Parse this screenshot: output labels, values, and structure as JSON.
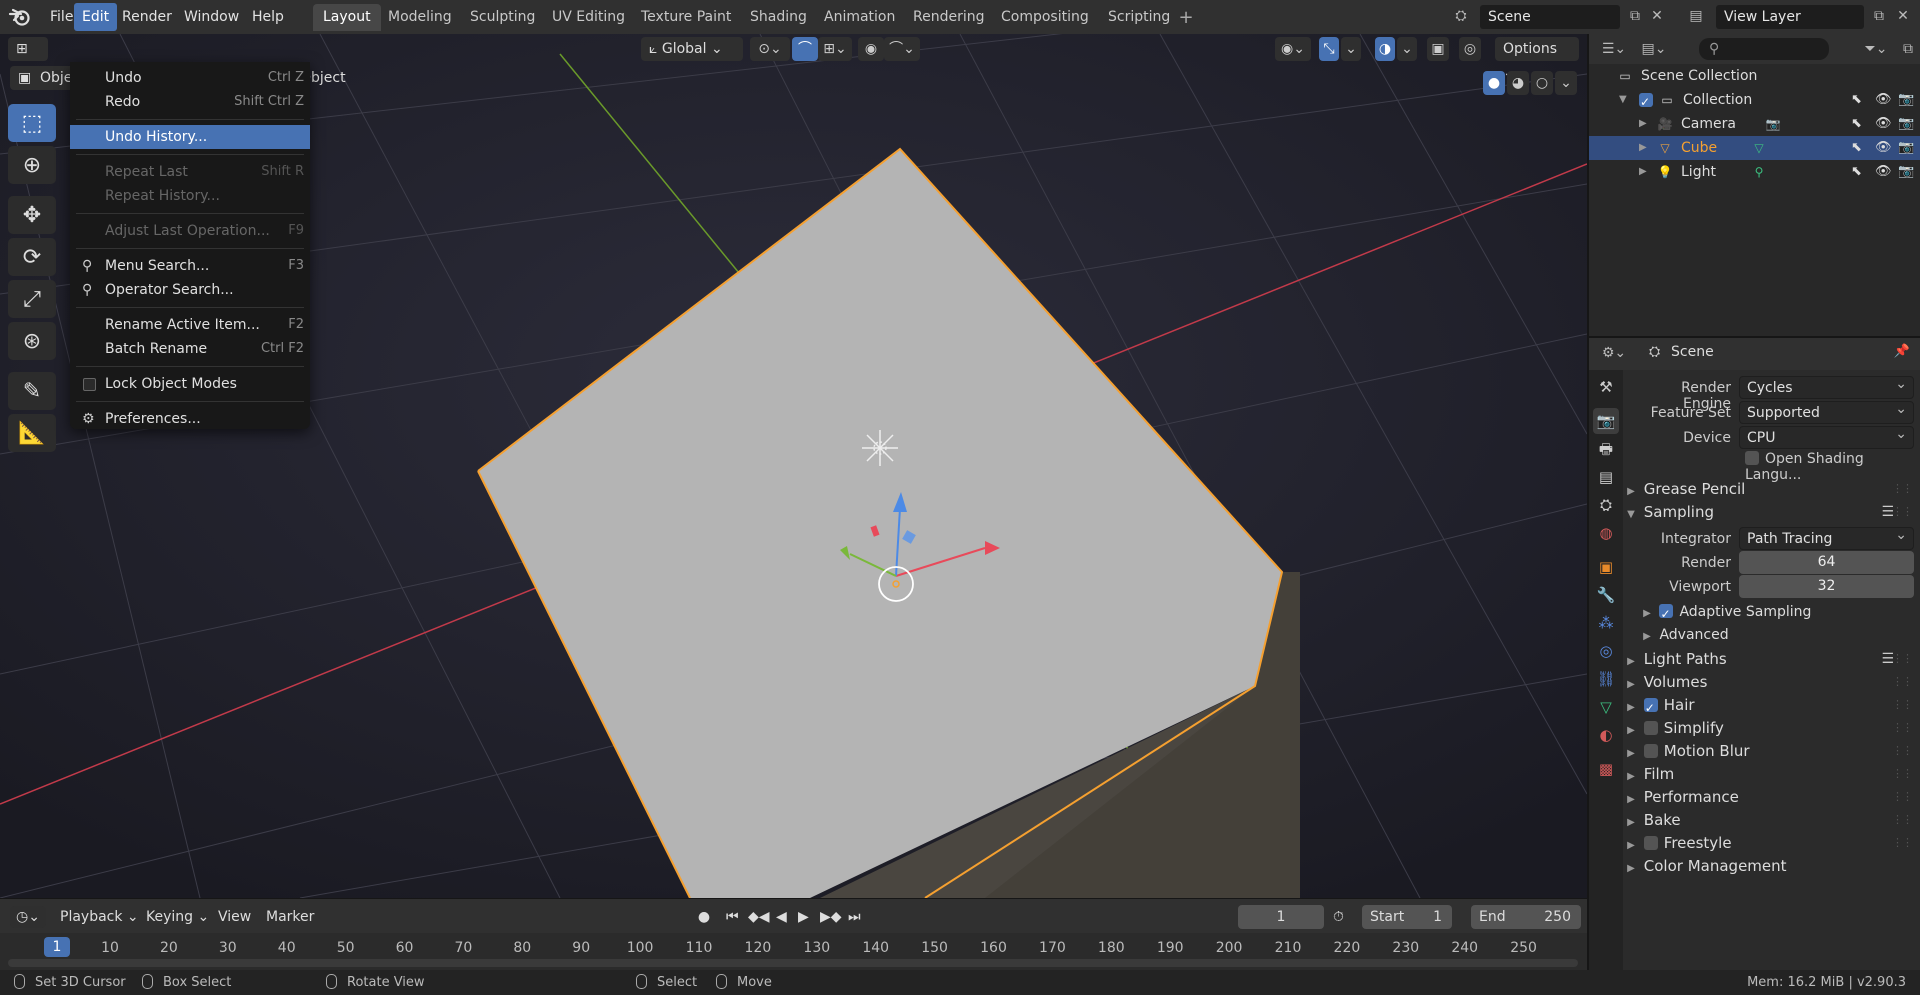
{
  "topbar": {
    "menus": [
      "File",
      "Edit",
      "Render",
      "Window",
      "Help"
    ],
    "active_menu": "Edit",
    "workspaces": [
      "Layout",
      "Modeling",
      "Sculpting",
      "UV Editing",
      "Texture Paint",
      "Shading",
      "Animation",
      "Rendering",
      "Compositing",
      "Scripting"
    ],
    "active_workspace": "Layout",
    "scene": "Scene",
    "view_layer": "View Layer"
  },
  "viewport": {
    "mode": "Object",
    "object_menu": "Object",
    "transform_orientation": "Global",
    "options_label": "Options"
  },
  "edit_menu": {
    "items": [
      {
        "label": "Undo",
        "shortcut": "Ctrl Z",
        "state": "normal"
      },
      {
        "label": "Redo",
        "shortcut": "Shift Ctrl Z",
        "state": "normal"
      },
      {
        "sep": true
      },
      {
        "label": "Undo History...",
        "shortcut": "",
        "state": "highlight"
      },
      {
        "sep": true
      },
      {
        "label": "Repeat Last",
        "shortcut": "Shift R",
        "state": "disabled"
      },
      {
        "label": "Repeat History...",
        "shortcut": "",
        "state": "disabled"
      },
      {
        "sep": true
      },
      {
        "label": "Adjust Last Operation...",
        "shortcut": "F9",
        "state": "disabled"
      },
      {
        "sep": true
      },
      {
        "label": "Menu Search...",
        "shortcut": "F3",
        "state": "normal",
        "icon": "search-icon"
      },
      {
        "label": "Operator Search...",
        "shortcut": "",
        "state": "normal",
        "icon": "search-icon"
      },
      {
        "sep": true
      },
      {
        "label": "Rename Active Item...",
        "shortcut": "F2",
        "state": "normal"
      },
      {
        "label": "Batch Rename",
        "shortcut": "Ctrl F2",
        "state": "normal"
      },
      {
        "sep": true
      },
      {
        "label": "Lock Object Modes",
        "shortcut": "",
        "state": "normal",
        "checkbox": false
      },
      {
        "sep": true
      },
      {
        "label": "Preferences...",
        "shortcut": "",
        "state": "normal",
        "icon": "gear-icon"
      }
    ]
  },
  "timeline": {
    "menus": [
      "Playback",
      "Keying",
      "View",
      "Marker"
    ],
    "current_frame": "1",
    "start_label": "Start",
    "start": "1",
    "end_label": "End",
    "end": "250",
    "ruler": [
      "1",
      "10",
      "20",
      "30",
      "40",
      "50",
      "60",
      "70",
      "80",
      "90",
      "100",
      "110",
      "120",
      "130",
      "140",
      "150",
      "160",
      "170",
      "180",
      "190",
      "200",
      "210",
      "220",
      "230",
      "240",
      "250"
    ]
  },
  "statusbar": {
    "left": [
      {
        "label": "Set 3D Cursor"
      },
      {
        "label": "Box Select"
      },
      {
        "label": "Rotate View"
      },
      {
        "label": "Select"
      },
      {
        "label": "Move"
      }
    ],
    "right": "Mem: 16.2 MiB | v2.90.3"
  },
  "outliner": {
    "root": "Scene Collection",
    "rows": [
      {
        "label": "Collection",
        "kind": "collection",
        "selected": false
      },
      {
        "label": "Camera",
        "kind": "camera",
        "selected": false
      },
      {
        "label": "Cube",
        "kind": "mesh",
        "selected": true
      },
      {
        "label": "Light",
        "kind": "light",
        "selected": false
      }
    ]
  },
  "properties": {
    "context": "Scene",
    "render_engine_label": "Render Engine",
    "render_engine": "Cycles",
    "feature_set_label": "Feature Set",
    "feature_set": "Supported",
    "device_label": "Device",
    "device": "CPU",
    "osl_label": "Open Shading Langu...",
    "grease_pencil": "Grease Pencil",
    "sampling": "Sampling",
    "integrator_label": "Integrator",
    "integrator": "Path Tracing",
    "render_label": "Render",
    "render_samples": "64",
    "viewport_label": "Viewport",
    "viewport_samples": "32",
    "adaptive_sampling": "Adaptive Sampling",
    "advanced": "Advanced",
    "light_paths": "Light Paths",
    "volumes": "Volumes",
    "hair": "Hair",
    "simplify": "Simplify",
    "motion_blur": "Motion Blur",
    "film": "Film",
    "performance": "Performance",
    "bake": "Bake",
    "freestyle": "Freestyle",
    "color_management": "Color Management"
  },
  "colors": {
    "accent": "#4772b3",
    "selection_outline": "#f5a030",
    "x_axis": "#c23a4a",
    "y_axis": "#6a9a2a"
  }
}
